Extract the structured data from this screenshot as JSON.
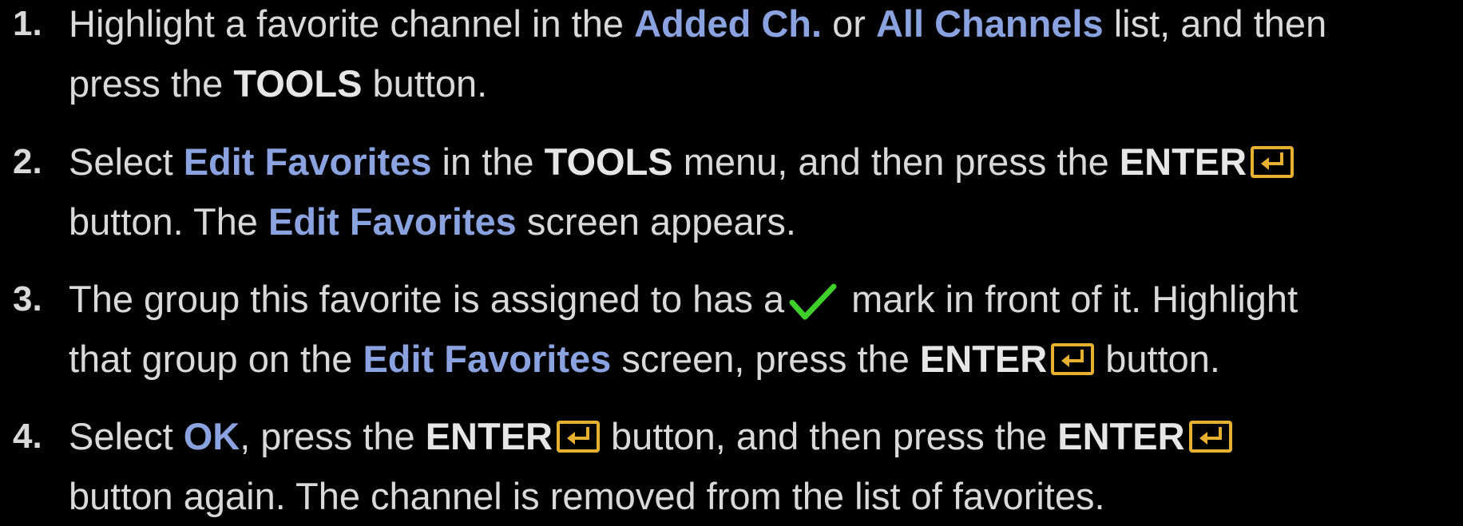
{
  "colors": {
    "background": "#000000",
    "text": "#d9d9d9",
    "highlight_blue": "#8aa3e0",
    "enter_icon": "#e8b030",
    "check_icon": "#3fcf2a"
  },
  "icons": {
    "enter": "enter-key-icon",
    "check": "checkmark-icon"
  },
  "steps": [
    {
      "number": "1.",
      "t1": "Highlight a favorite channel in the ",
      "added_ch": "Added Ch.",
      "t2": " or ",
      "all_channels": "All Channels",
      "t3": " list, and then",
      "t4": "press the ",
      "tools": "TOOLS",
      "t5": " button."
    },
    {
      "number": "2.",
      "t1": "Select ",
      "edit_favorites": "Edit Favorites",
      "t2": " in the ",
      "tools": "TOOLS",
      "t3": " menu, and then press the ",
      "enter": "ENTER",
      "t4": "button. The ",
      "edit_favorites_2": "Edit Favorites",
      "t5": " screen appears."
    },
    {
      "number": "3.",
      "t1": "The group this favorite is assigned to has a",
      "t2": "mark in front of it. Highlight",
      "t3": "that group on the ",
      "edit_favorites": "Edit Favorites",
      "t4": " screen, press the ",
      "enter": "ENTER",
      "t5": " button."
    },
    {
      "number": "4.",
      "t1": "Select ",
      "ok": "OK",
      "t2": ", press the ",
      "enter": "ENTER",
      "t3": " button, and then press the ",
      "enter_2": "ENTER",
      "t4": "button again. The channel is removed from the list of favorites."
    }
  ]
}
